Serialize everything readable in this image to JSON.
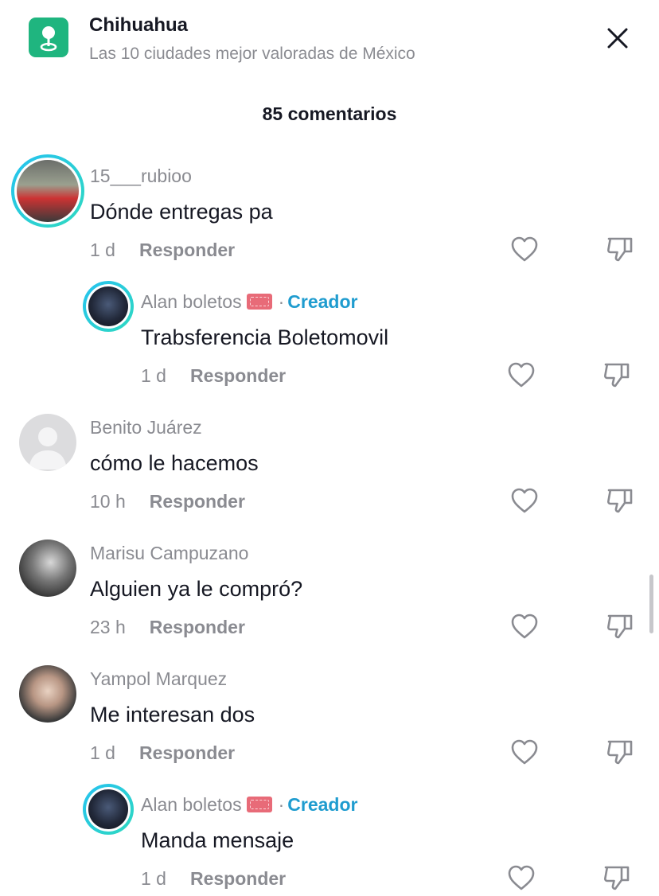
{
  "header": {
    "title": "Chihuahua",
    "subtitle": "Las 10 ciudades mejor valoradas de México"
  },
  "comment_count": "85 comentarios",
  "reply_label": "Responder",
  "creator_label": "Creador",
  "dot": "·",
  "comments": [
    {
      "user": "15___rubioo",
      "text": "Dónde entregas pa",
      "time": "1 d"
    },
    {
      "user": "Alan boletos",
      "text": "Trabsferencia Boletomovil",
      "time": "1 d"
    },
    {
      "user": "Benito Juárez",
      "text": "cómo le hacemos",
      "time": "10 h"
    },
    {
      "user": "Marisu Campuzano",
      "text": "Alguien ya le compró?",
      "time": "23 h"
    },
    {
      "user": "Yampol Marquez",
      "text": "Me interesan dos",
      "time": "1 d"
    },
    {
      "user": "Alan boletos",
      "text": "Manda mensaje",
      "time": "1 d"
    }
  ],
  "colors": {
    "accent_creator": "#1f9ccf",
    "location_icon_bg": "#1fb57f",
    "ring_gradient": [
      "#25c2f0",
      "#2fd9c0"
    ]
  },
  "icons": [
    "location-pin-icon",
    "close-icon",
    "heart-icon",
    "dislike-icon",
    "ticket-emoji-icon"
  ]
}
